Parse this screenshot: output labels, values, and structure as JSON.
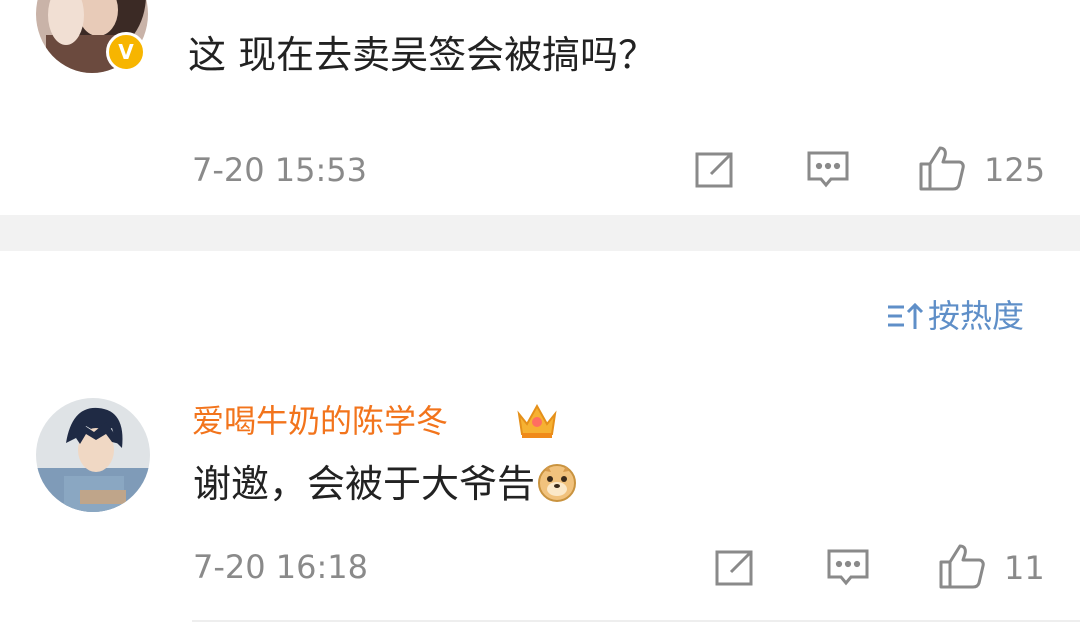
{
  "top_comment": {
    "text": "这 现在去卖吴签会被搞吗？",
    "timestamp": "7-20 15:53",
    "like_count": "125",
    "badge": "V",
    "icons": [
      "share-icon",
      "comment-icon",
      "like-icon"
    ]
  },
  "sort": {
    "label": "按热度",
    "icon": "sort-icon"
  },
  "reply_comment": {
    "username": "爱喝牛奶的陈学冬",
    "text": "谢邀，会被于大爷告",
    "timestamp": "7-20 16:18",
    "like_count": "11",
    "badge_icon": "crown-icon",
    "emoji_icon": "doge-emoji-icon",
    "icons": [
      "share-icon",
      "comment-icon",
      "like-icon"
    ]
  },
  "colors": {
    "username": "#f2741c",
    "sort_link": "#5f8fc8",
    "meta_gray": "#8a8a8a",
    "divider": "#f2f2f2",
    "verified_badge": "#f7b500"
  }
}
